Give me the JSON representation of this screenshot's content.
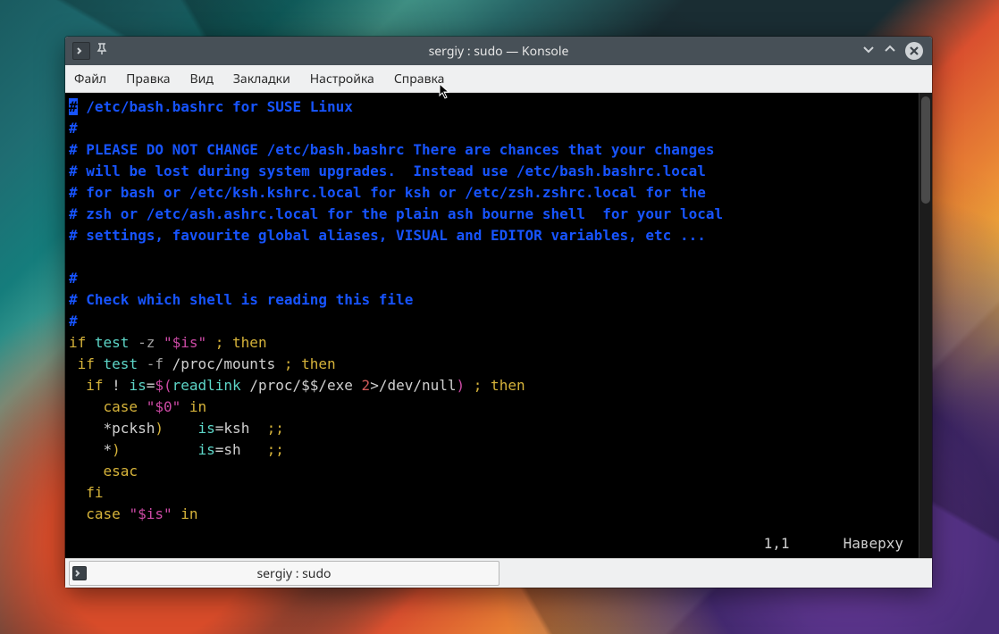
{
  "window": {
    "title": "sergiy : sudo — Konsole"
  },
  "menu": {
    "file": "Файл",
    "edit": "Правка",
    "view": "Вид",
    "bookmarks": "Закладки",
    "settings": "Настройка",
    "help": "Справка"
  },
  "code": {
    "hash": "#",
    "l01": " /etc/bash.bashrc for SUSE Linux",
    "l03": " PLEASE DO NOT CHANGE /etc/bash.bashrc There are chances that your changes",
    "l04": " will be lost during system upgrades.  Instead use /etc/bash.bashrc.local",
    "l05": " for bash or /etc/ksh.kshrc.local for ksh or /etc/zsh.zshrc.local for the",
    "l06": " zsh or /etc/ash.ashrc.local for the plain ash bourne shell  for your local",
    "l07": " settings, favourite global aliases, VISUAL and EDITOR variables, etc ...",
    "l09": " Check which shell is reading this file",
    "if": "if",
    "test": " test ",
    "minus_z": "-z ",
    "is_var": "\"$is\"",
    "semi_then": " ; then",
    "sp1": " ",
    "minus_f": "-f ",
    "proc_mounts": "/proc/mounts",
    "sp2": "  ",
    "bang": "! ",
    "is_eq": "is",
    "eq": "=",
    "dollar_open": "$(",
    "readlink": "readlink ",
    "proc_exe": "/proc/$$/exe ",
    "two": "2",
    "redir_null": ">/dev/null",
    "close_paren": ")",
    "case_indent": "    ",
    "case": "case",
    "sp": " ",
    "zero_var": "\"$0\"",
    "in": " in",
    "star_pcksh_indent": "    *",
    "pcksh": "pcksh",
    "paren": ")",
    "gap1": "    ",
    "is_eq_ksh": "is",
    "ksh": "ksh  ",
    "dsemi": ";;",
    "star_indent": "    *",
    "gap2": "         ",
    "sh": "sh   ",
    "esac_indent": "    ",
    "esac": "esac",
    "fi_indent": "  ",
    "fi": "fi",
    "case2_indent": "  "
  },
  "status": {
    "position": "1,1",
    "scroll": "Наверху"
  },
  "tab": {
    "label": "sergiy : sudo"
  }
}
